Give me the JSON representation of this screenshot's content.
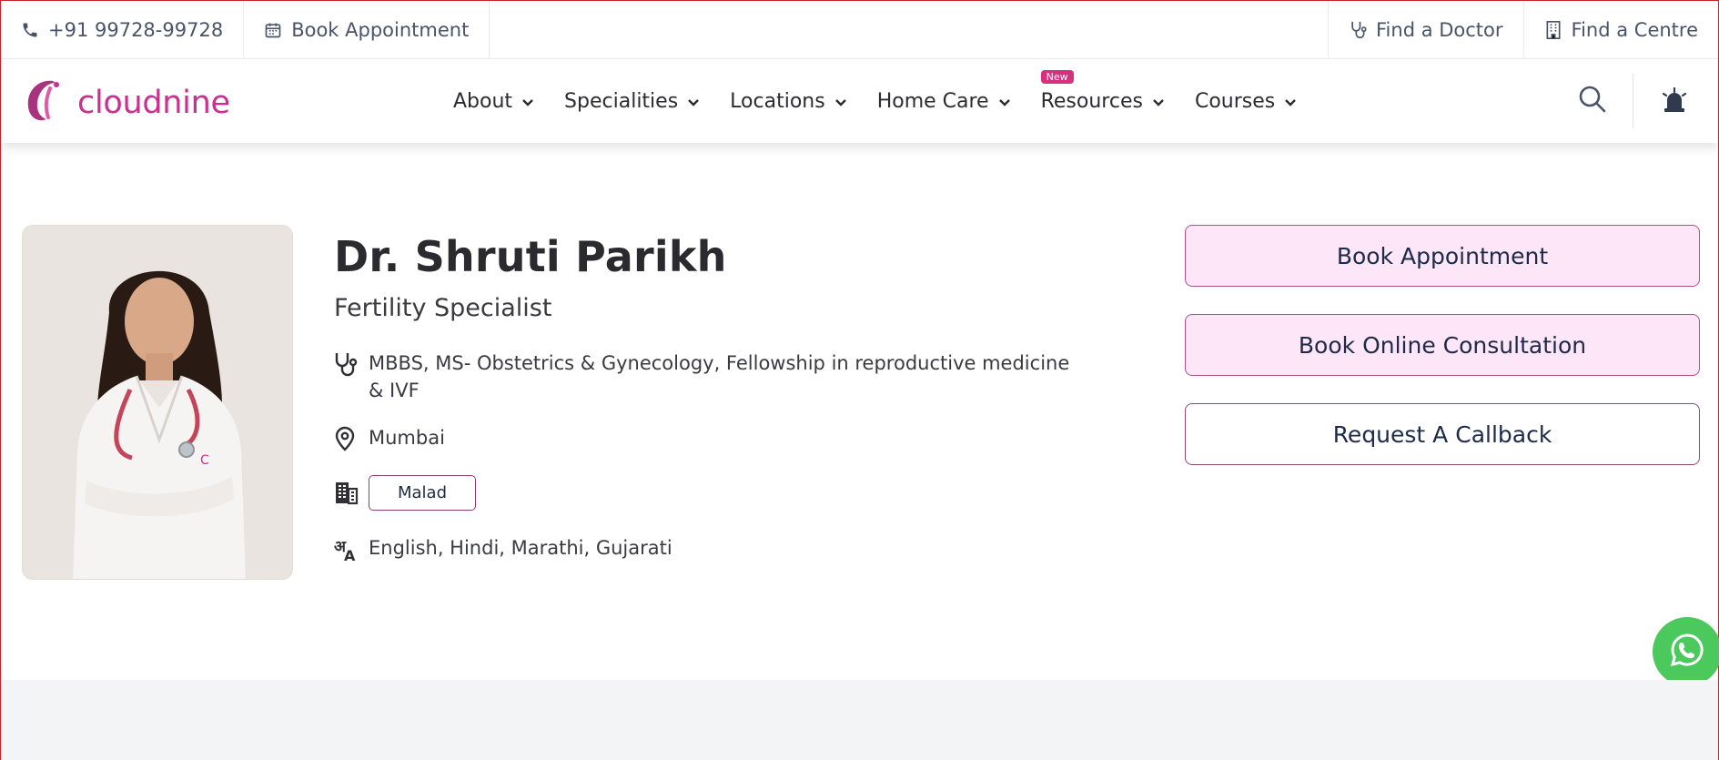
{
  "topbar": {
    "phone": "+91 99728-99728",
    "book_appointment": "Book Appointment",
    "find_doctor": "Find a Doctor",
    "find_centre": "Find a Centre"
  },
  "brand": {
    "name": "cloudnine",
    "color": "#c8318f"
  },
  "nav": {
    "items": [
      "About",
      "Specialities",
      "Locations",
      "Home Care",
      "Resources",
      "Courses"
    ],
    "new_badge": "New"
  },
  "doctor": {
    "name": "Dr. Shruti Parikh",
    "title": "Fertility Specialist",
    "qualifications": "MBBS, MS- Obstetrics & Gynecology, Fellowship in reproductive medicine & IVF",
    "city": "Mumbai",
    "centre": "Malad",
    "languages": "English, Hindi, Marathi, Gujarati"
  },
  "actions": {
    "book_appointment": "Book Appointment",
    "book_online": "Book Online Consultation",
    "callback": "Request A Callback"
  },
  "colors": {
    "accent_pink": "#fde6f7",
    "whatsapp_green": "#4bc95d",
    "badge": "#d6307e"
  }
}
